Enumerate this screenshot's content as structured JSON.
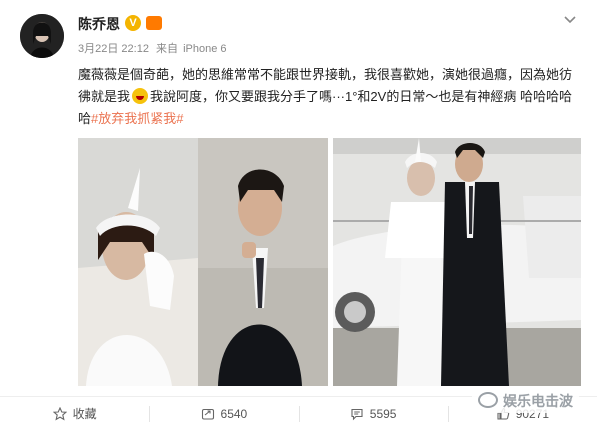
{
  "post": {
    "username": "陈乔恩",
    "vip_badge": "V",
    "timestamp": "3月22日 22:12",
    "source_prefix": "来自",
    "source": "iPhone 6",
    "text_part1": "魔薇薇是個奇葩，她的思維常常不能跟世界接軌，我很喜歡她，演她很過癮，因為她彷彿就是我",
    "emoji_name": "laughing-emoji",
    "text_part2": "我說阿度，你又要跟我分手了嗎···1°和2V的日常～也是有神經病 哈哈哈哈哈",
    "hashtag": "#放弃我抓紧我#"
  },
  "actions": {
    "favorite_label": "收藏",
    "repost_count": "6540",
    "comment_count": "5595",
    "like_count": "90271"
  },
  "watermark": {
    "text": "娱乐电击波"
  },
  "colors": {
    "hashtag": "#eb7350",
    "vip": "#f4b400"
  }
}
